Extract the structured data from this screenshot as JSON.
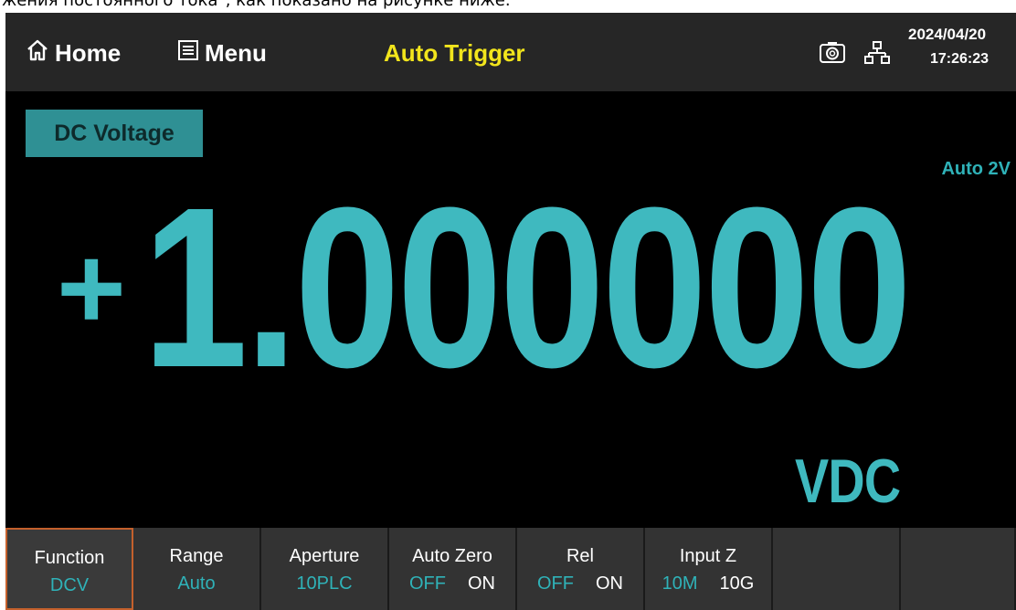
{
  "caption": "жения постоянного тока\", как показано на рисунке ниже.",
  "topbar": {
    "home_label": "Home",
    "menu_label": "Menu",
    "trigger_label": "Auto Trigger",
    "date": "2024/04/20",
    "time": "17:26:23",
    "home_icon": "home-icon",
    "menu_icon": "menu-icon",
    "camera_icon": "camera-icon",
    "network_icon": "network-icon"
  },
  "measurement": {
    "function_name": "DC Voltage",
    "range_label": "Auto 2V",
    "sign": "+",
    "value": "1.000000",
    "unit": "VDC"
  },
  "softkeys": [
    {
      "title": "Function",
      "value": "DCV"
    },
    {
      "title": "Range",
      "value": "Auto"
    },
    {
      "title": "Aperture",
      "value": "10PLC"
    },
    {
      "title": "Auto Zero",
      "options": [
        "OFF",
        "ON"
      ],
      "selected": "OFF"
    },
    {
      "title": "Rel",
      "options": [
        "OFF",
        "ON"
      ],
      "selected": "OFF"
    },
    {
      "title": "Input Z",
      "options": [
        "10M",
        "10G"
      ],
      "selected": "10M"
    }
  ],
  "colors": {
    "accent": "#3fb9bf",
    "trigger": "#f2e51c",
    "tag_bg": "#2f9094",
    "active_border": "#c4602c"
  }
}
